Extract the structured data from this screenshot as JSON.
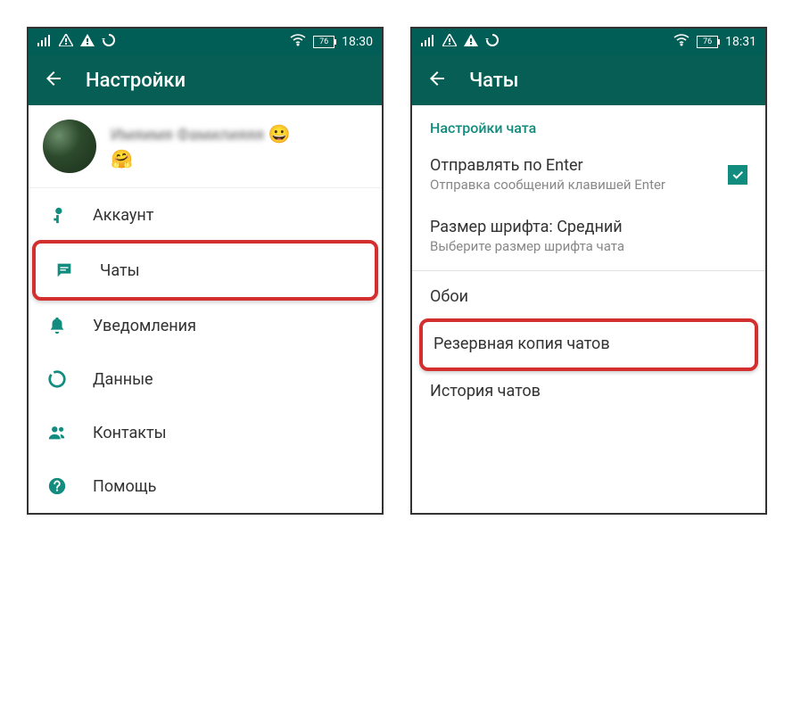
{
  "left": {
    "status": {
      "battery": "76",
      "time": "18:30"
    },
    "title": "Настройки",
    "profile": {
      "emoji1": "😀",
      "emoji2": "🤗"
    },
    "menu": {
      "account": "Аккаунт",
      "chats": "Чаты",
      "notifications": "Уведомления",
      "data": "Данные",
      "contacts": "Контакты",
      "help": "Помощь"
    }
  },
  "right": {
    "status": {
      "battery": "76",
      "time": "18:31"
    },
    "title": "Чаты",
    "section_header": "Настройки чата",
    "enter": {
      "title": "Отправлять по Enter",
      "sub": "Отправка сообщений клавишей Enter"
    },
    "fontsize": {
      "title": "Размер шрифта: Средний",
      "sub": "Выберите размер шрифта чата"
    },
    "wallpaper": "Обои",
    "backup": "Резервная копия чатов",
    "history": "История чатов"
  }
}
